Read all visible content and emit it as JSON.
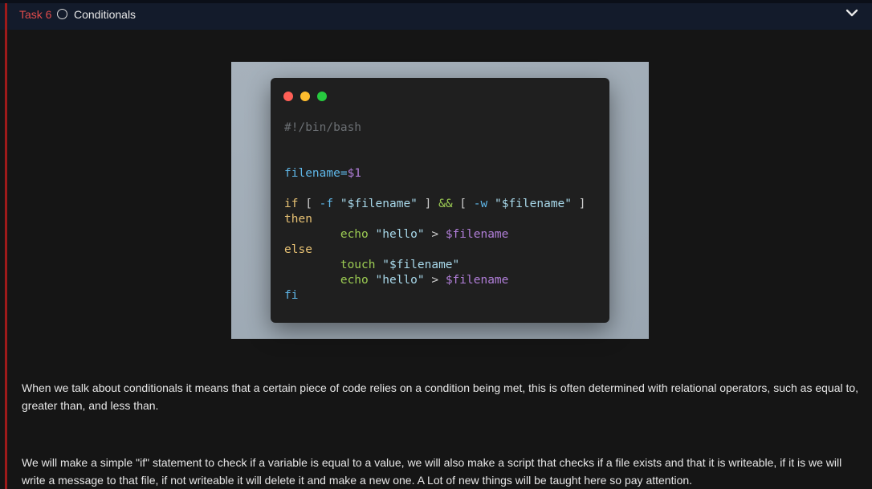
{
  "header": {
    "task_label": "Task 6",
    "title": "Conditionals",
    "status_icon": "circle-outline-icon",
    "expand_icon": "chevron-down-icon"
  },
  "code_window": {
    "lines": [
      "#!/bin/bash",
      "",
      "",
      "filename=$1",
      "",
      "if [ -f \"$filename\" ] && [ -w \"$filename\" ]",
      "then",
      "        echo \"hello\" > $filename",
      "else",
      "        touch \"$filename\"",
      "        echo \"hello\" > $filename",
      "fi"
    ]
  },
  "content": {
    "paragraph_1": "When we talk about conditionals it means that a certain piece of code relies on a condition being met, this is often determined with relational operators, such as equal to, greater than, and less than.",
    "paragraph_2": "We will make a simple \"if\" statement to check if a variable is equal to a value, we will also make a script that checks if a file exists and that it is writeable, if it is we will write a message to that file, if not writeable it will delete it and make a new one. A Lot of new things will be taught here so pay attention."
  },
  "colors": {
    "task_label": "#e04b4b",
    "accent_bar": "#9e1a1a",
    "header_bg": "#131b2b",
    "page_bg": "#151515"
  }
}
